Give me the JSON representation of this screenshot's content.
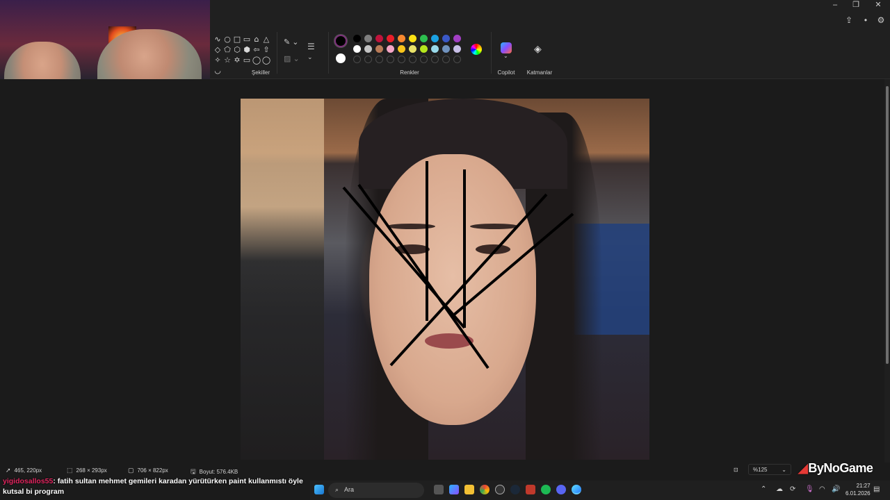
{
  "ribbon": {
    "shapes_label": "Şekiller",
    "colors_label": "Renkler",
    "copilot_label": "Copilot",
    "layers_label": "Katmanlar",
    "shape_glyphs": [
      "∿",
      "○",
      "□",
      "▭",
      "⌂",
      "△",
      "◇",
      "⬠",
      "⬡",
      "⬢",
      "⇦",
      "⇧",
      "✧",
      "☆",
      "✡",
      "▭",
      "◯",
      "◯",
      "◡"
    ],
    "palette": [
      "#000000",
      "#7f7f7f",
      "#c0143c",
      "#e81e2a",
      "#f7882f",
      "#fbe214",
      "#2dbf4f",
      "#1ba1e2",
      "#3a58c7",
      "#a23fc4",
      "#ffffff",
      "#c3c3c3",
      "#b97a57",
      "#f4a6c6",
      "#f8c51c",
      "#e9e26a",
      "#b5e61d",
      "#99d9ea",
      "#7092be",
      "#c8bfe7"
    ]
  },
  "window": {
    "minimize": "–",
    "maximize": "❐",
    "close": "✕"
  },
  "status": {
    "cursor_pos": "465, 220px",
    "selection_size": "268 × 293px",
    "canvas_size": "706 × 822px",
    "file_size": "Boyut: 576.4KB",
    "zoom": "%125"
  },
  "watermark": "ByNoGame",
  "chat": {
    "username": "yigidosallos55",
    "message": ": fatih sultan mehmet gemileri karadan yürütürken paint kullanmıstı öyle kutsal bi program"
  },
  "taskbar": {
    "search_placeholder": "Ara",
    "time": "21:27",
    "date": "6.01.2026"
  }
}
